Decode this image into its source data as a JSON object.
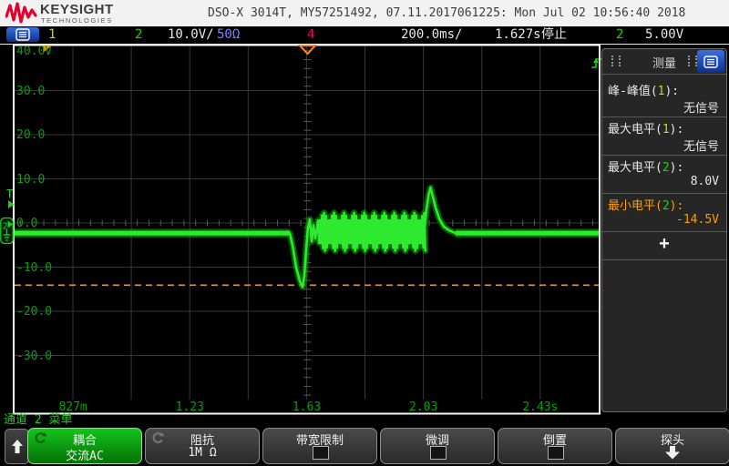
{
  "header": {
    "brand": "KEYSIGHT",
    "brand_sub": "TECHNOLOGIES",
    "title": "DSO-X 3014T, MY57251492, 07.11.2017061225: Mon Jul 02 10:56:40 2018"
  },
  "status": {
    "ch1": "1",
    "ch2": "2",
    "ch2_scale": "10.0V/",
    "ch2_impedance": "50Ω",
    "ch4": "4",
    "timebase": "200.0ms/",
    "delay": "1.627s",
    "run_state": "停止",
    "trig_source": "2",
    "trig_level": "5.00V"
  },
  "channel_colors": {
    "1": "#d6d600",
    "2": "#17d317",
    "4": "#e8006c",
    "imp": "#8080ff"
  },
  "graticule": {
    "volt_labels": [
      "40.0V",
      "30.0",
      "20.0",
      "10.0",
      "0.0",
      "-10.0",
      "-20.0",
      "-30.0"
    ],
    "time_labels": [
      "827m",
      "1.23",
      "1.63",
      "2.03",
      "2.43s"
    ],
    "grid_color": "#383838",
    "frame_color": "#f8f8f8"
  },
  "waveform": {
    "channel": "2",
    "color": "#2eea2e",
    "glow_color": "#009900",
    "baseline_v": -2.3,
    "min_v": -14.5,
    "max_v": 8.0,
    "burst_center_v": -2.0,
    "burst_amp_v": 4.3,
    "threshold_v": -14.5,
    "threshold_color": "#ff8c1a"
  },
  "sidebar": {
    "title": "测量",
    "items": [
      {
        "name": "峰-峰值",
        "source": "1",
        "value": "无信号",
        "selected": false
      },
      {
        "name": "最大电平",
        "source": "1",
        "value": "无信号",
        "selected": false
      },
      {
        "name": "最大电平",
        "source": "2",
        "value": "8.0V",
        "selected": false
      },
      {
        "name": "最小电平",
        "source": "2",
        "value": "-14.5V",
        "selected": true
      }
    ],
    "add_label": "+"
  },
  "menu": {
    "title": "通道 2 菜单",
    "keys": [
      {
        "top": "耦合",
        "bottom": "交流AC"
      },
      {
        "top": "阻抗",
        "bottom": "1M Ω"
      },
      {
        "top": "带宽限制"
      },
      {
        "top": "微调"
      },
      {
        "top": "倒置"
      },
      {
        "top": "探头"
      }
    ]
  }
}
